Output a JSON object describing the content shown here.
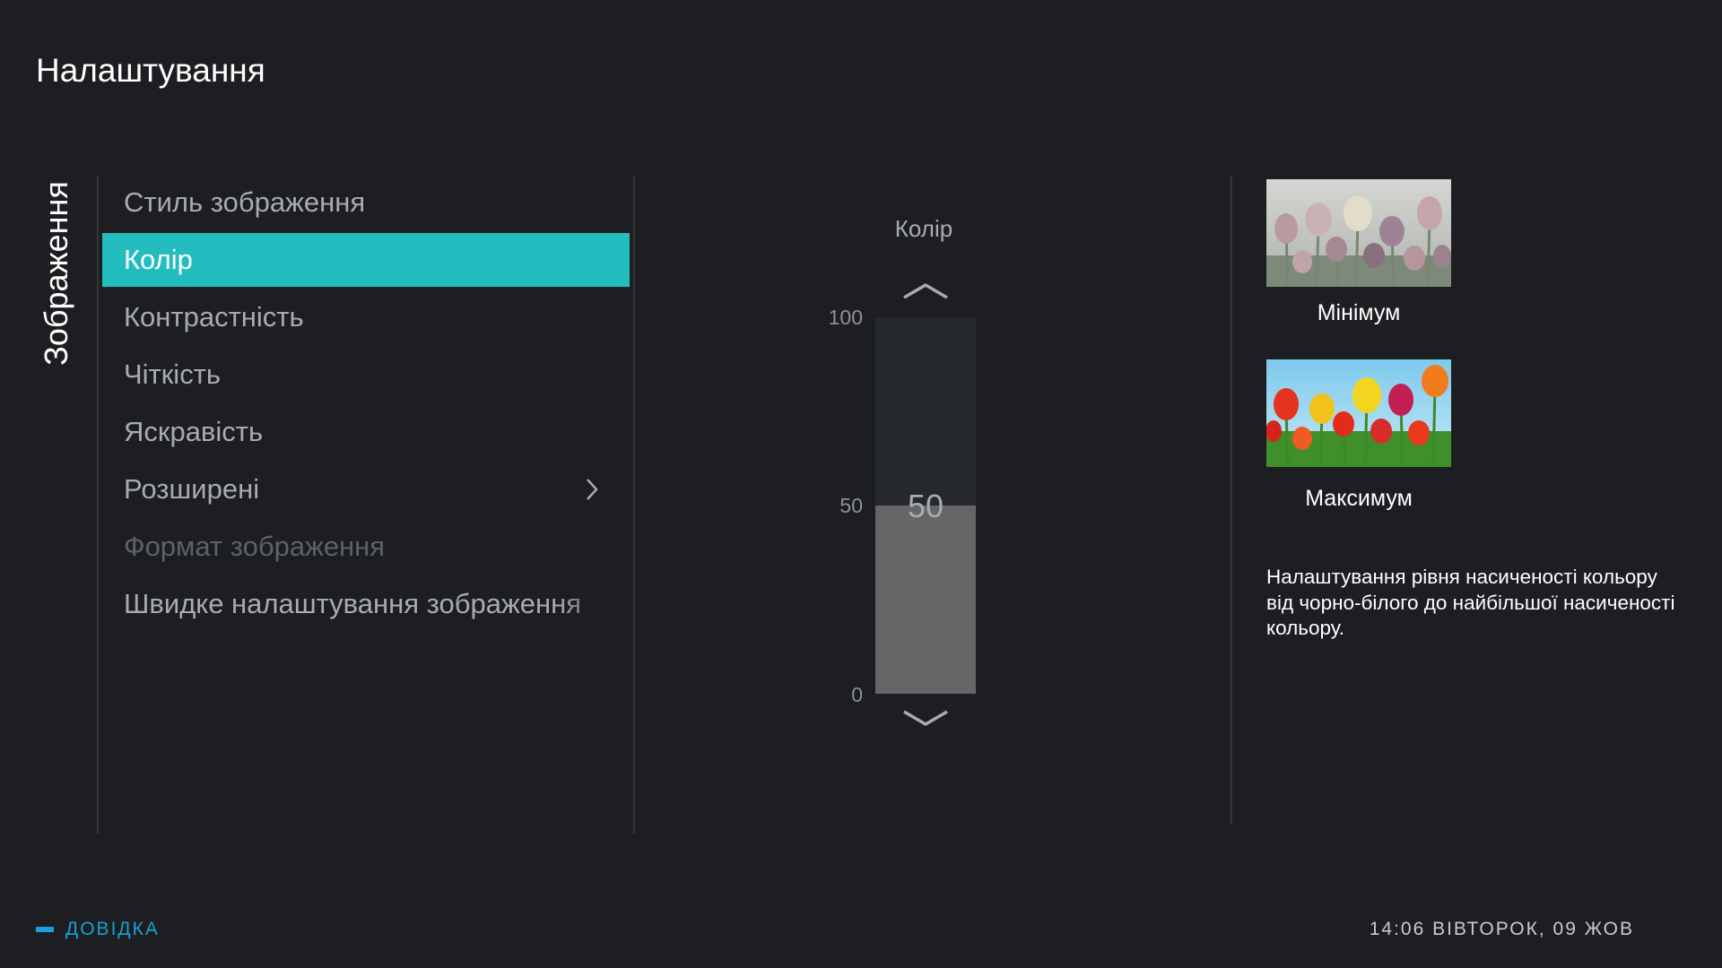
{
  "header": {
    "title": "Налаштування"
  },
  "section": {
    "label": "Зображення"
  },
  "menu": {
    "items": [
      {
        "label": "Стиль зображення",
        "state": "normal"
      },
      {
        "label": "Колір",
        "state": "selected"
      },
      {
        "label": "Контрастність",
        "state": "normal"
      },
      {
        "label": "Чіткість",
        "state": "normal"
      },
      {
        "label": "Яскравість",
        "state": "normal"
      },
      {
        "label": "Розширені",
        "state": "normal",
        "has_submenu": true
      },
      {
        "label": "Формат зображення",
        "state": "disabled"
      },
      {
        "label": "Швидке налаштування зображення",
        "state": "normal"
      }
    ]
  },
  "slider": {
    "title": "Колір",
    "value": 50,
    "min": 0,
    "max": 100,
    "ticks": [
      "100",
      "50",
      "0"
    ],
    "value_label": "50"
  },
  "preview": {
    "min_label": "Мінімум",
    "max_label": "Максимум",
    "description": "Налаштування рівня насиченості кольору від чорно-білого до найбільшої насиченості кольору."
  },
  "footer": {
    "help_label": "ДОВІДКА",
    "clock": "14:06 ВІВТОРОК, 09 ЖОВ"
  },
  "colors": {
    "background": "#1c1e21",
    "selection": "#24bdbf",
    "help_accent": "#1aa0d8",
    "slider_fill": "#666666",
    "slider_track": "#26292d"
  },
  "icons": {
    "submenu": "chevron-right-icon",
    "slider_up": "chevron-up-icon",
    "slider_down": "chevron-down-icon"
  }
}
